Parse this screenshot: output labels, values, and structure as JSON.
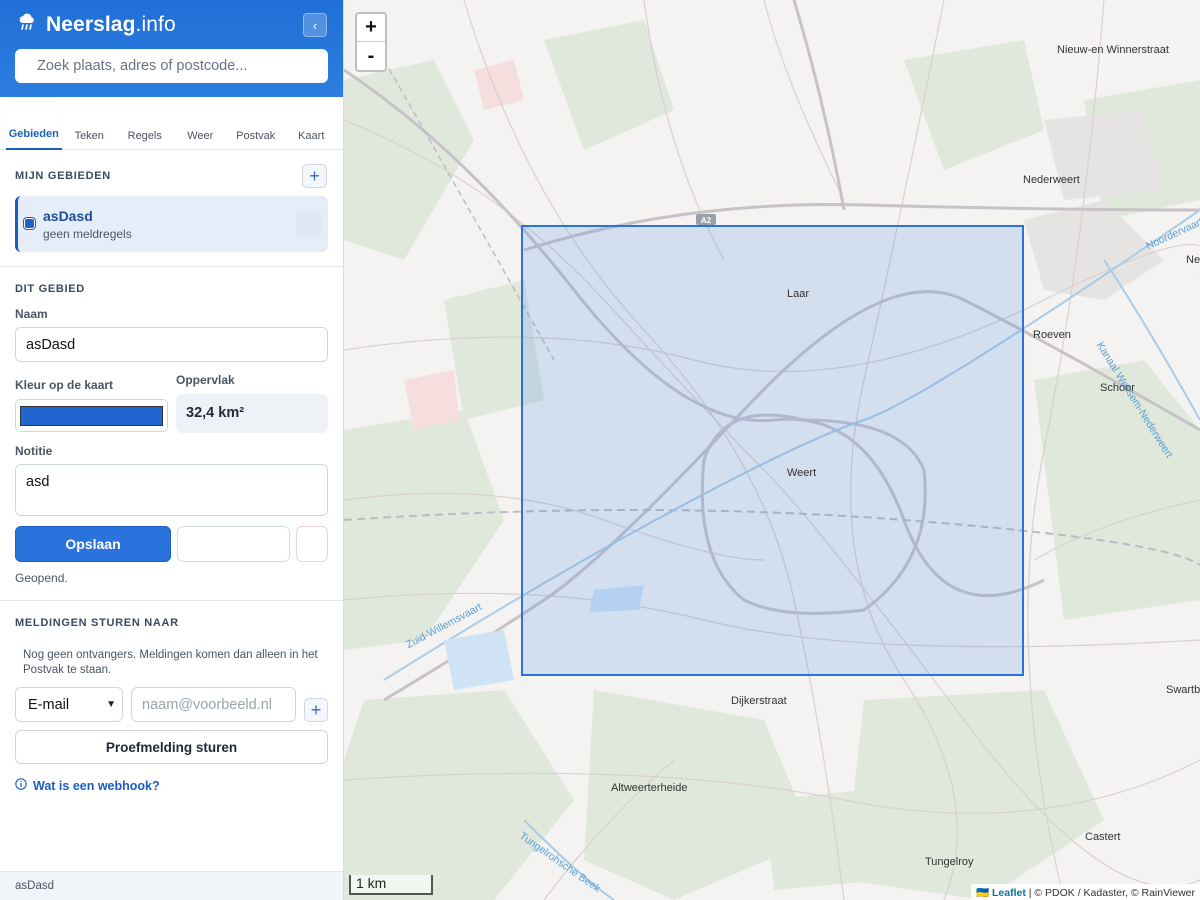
{
  "app": {
    "brand_bold": "Neerslag",
    "brand_suffix": ".info",
    "logo_icon": "rain-cloud-icon",
    "collapse_icon": "chevron-left-icon"
  },
  "search": {
    "placeholder": "Zoek plaats, adres of postcode..."
  },
  "tabs": [
    {
      "label": "Gebieden",
      "active": true
    },
    {
      "label": "Teken"
    },
    {
      "label": "Regels"
    },
    {
      "label": "Weer"
    },
    {
      "label": "Postvak"
    },
    {
      "label": "Kaart"
    }
  ],
  "my_areas": {
    "title": "MIJN GEBIEDEN",
    "add_label": "+",
    "items": [
      {
        "name": "asDasd",
        "sub": "geen meldregels",
        "color": "#1f63c8"
      }
    ]
  },
  "this_area": {
    "title": "DIT GEBIED",
    "name_label": "Naam",
    "name_value": "asDasd",
    "color_label": "Kleur op de kaart",
    "color_value": "#1f67cf",
    "area_label": "Oppervlak",
    "area_value": "32,4 km²",
    "notes_label": "Notitie",
    "notes_value": "asd",
    "save_label": "Opslaan",
    "status": "Geopend."
  },
  "notifications": {
    "title": "MELDINGEN STUREN NAAR",
    "empty_text": "Nog geen ontvangers. Meldingen komen dan alleen in het Postvak te staan.",
    "channel_selected": "E-mail",
    "email_placeholder": "naam@voorbeeld.nl",
    "add_label": "+",
    "test_label": "Proefmelding sturen",
    "webhook_link": "Wat is een webhook?",
    "info_icon": "info-icon"
  },
  "footer": {
    "text": "asDasd"
  },
  "map": {
    "zoom_in": "+",
    "zoom_out": "-",
    "scale_label": "1 km",
    "attribution_leaflet": "Leaflet",
    "attribution_rest": " | © PDOK / Kadaster, © RainViewer",
    "places": [
      "Nieuw-en Winnerstraat",
      "Nederweert",
      "Laar",
      "Roeven",
      "Schoor",
      "Weert",
      "Dijkerstraat",
      "Swartb",
      "Altweerterheide",
      "Castert",
      "Tungelroy",
      "Ne"
    ],
    "waterways": [
      "Noordervaart",
      "Kanaal Wessem-Nederweert",
      "Zuid-Willemsvaart",
      "Tungelrohsche Beek"
    ],
    "road_label": "A2",
    "selection_color": "#2a73dc"
  }
}
